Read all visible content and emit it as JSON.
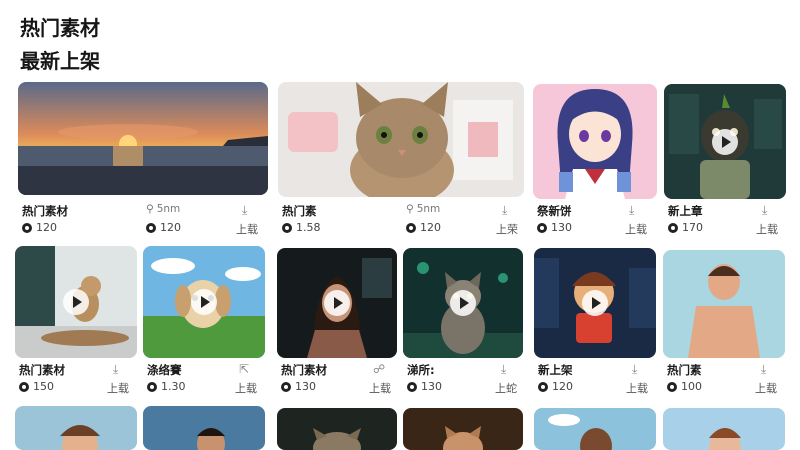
{
  "header": {
    "title": "热门素材",
    "subtitle": "最新上架"
  },
  "row1": [
    {
      "title": "热门素材",
      "views": "120",
      "size": "5nm",
      "count": "120",
      "download": "上载"
    },
    {
      "title": "热门素",
      "views": "1.58",
      "size": "5nm",
      "count": "120",
      "download": "上荣"
    },
    {
      "title": "祭新饼",
      "views": "130",
      "download": "上载"
    },
    {
      "title": "新上章",
      "views": "170",
      "download": "上载"
    }
  ],
  "row2": [
    {
      "title": "热门素材",
      "views": "150",
      "download": "上载"
    },
    {
      "title": "涤络賽",
      "views": "1.30",
      "download": "上载"
    },
    {
      "title": "热门素材",
      "views": "130",
      "download": "上载"
    },
    {
      "title": "涕所:",
      "views": "130",
      "download": "上蛇"
    },
    {
      "title": "新上架",
      "views": "120",
      "download": "上载"
    },
    {
      "title": "热门素",
      "views": "100",
      "download": "上载"
    }
  ],
  "icons": {
    "view": "eye-icon",
    "download": "download-arrow-icon",
    "size": "pin-icon",
    "play": "play-icon"
  }
}
